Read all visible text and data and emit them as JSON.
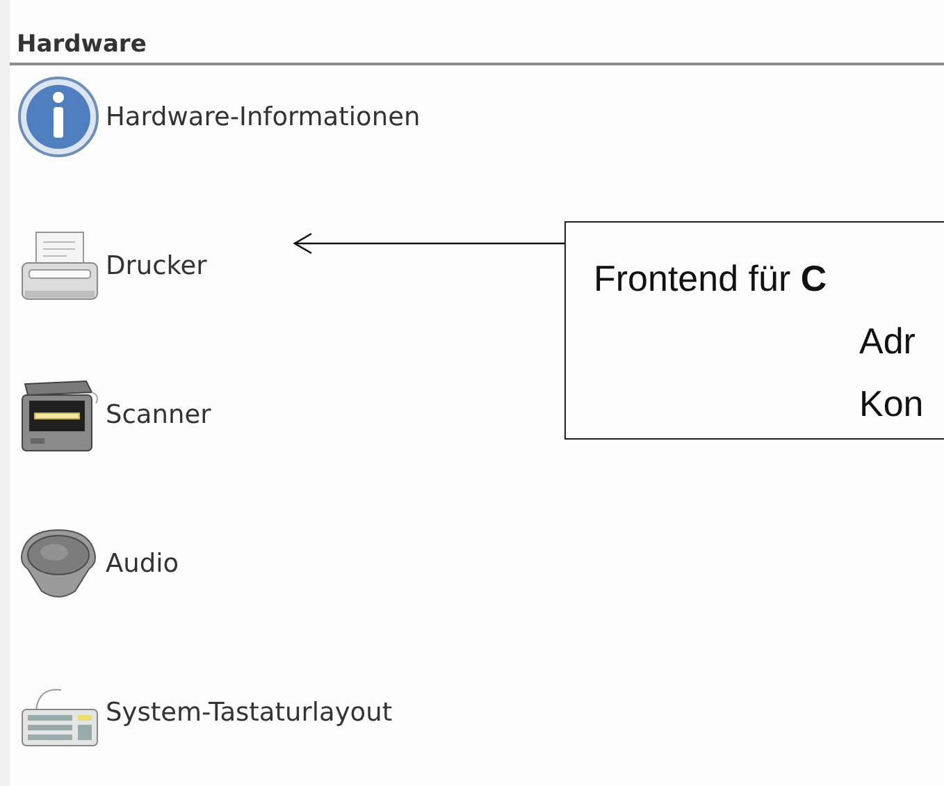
{
  "section": {
    "title": "Hardware"
  },
  "items": [
    {
      "kind": "info",
      "label": "Hardware-Informationen"
    },
    {
      "kind": "printer",
      "label": "Drucker"
    },
    {
      "kind": "scanner",
      "label": "Scanner"
    },
    {
      "kind": "audio",
      "label": "Audio"
    },
    {
      "kind": "keyboard",
      "label": "System-Tastaturlayout"
    }
  ],
  "callout": {
    "lines": [
      "Frontend für **C**",
      "Adr",
      "Kon"
    ]
  }
}
